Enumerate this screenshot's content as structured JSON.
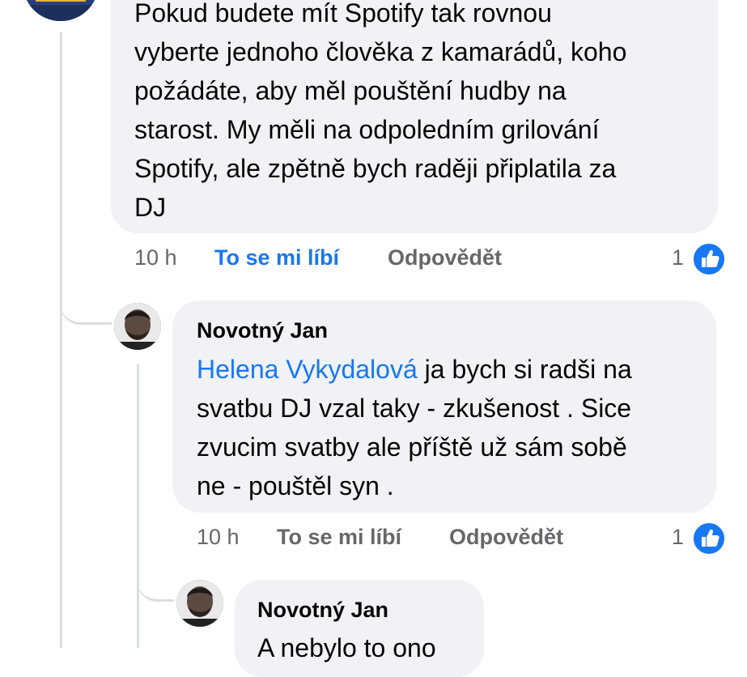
{
  "comments": [
    {
      "text": "Pokud budete mít Spotify tak rovnou\nvyberte jednoho člověka z kamarádů, koho\npožádáte, aby měl pouštění hudby na\nstarost. My měli na odpoledním grilování\nSpotify, ale zpětně bych raději připlatila za\nDJ",
      "time": "10 h",
      "like_label": "To se mi líbí",
      "like_active": true,
      "reply_label": "Odpovědět",
      "reaction_count": "1",
      "reaction_icon": "thumbs-up-icon"
    },
    {
      "author": "Novotný Jan",
      "mention": "Helena Vykydalová",
      "text_after_mention": " ja bych si radši na\nsvatbu DJ vzal taky - zkušenost . Sice\nzvucim svatby ale příště už sám sobě\nne - pouštěl syn .",
      "time": "10 h",
      "like_label": "To se mi líbí",
      "like_active": false,
      "reply_label": "Odpovědět",
      "reaction_count": "1",
      "reaction_icon": "thumbs-up-icon"
    },
    {
      "author": "Novotný Jan",
      "text_partial": "A nebylo to ono"
    }
  ],
  "colors": {
    "bubble": "#f0f2f5",
    "link": "#1877f2",
    "meta": "#65676b",
    "thread_line": "#dadde1"
  }
}
